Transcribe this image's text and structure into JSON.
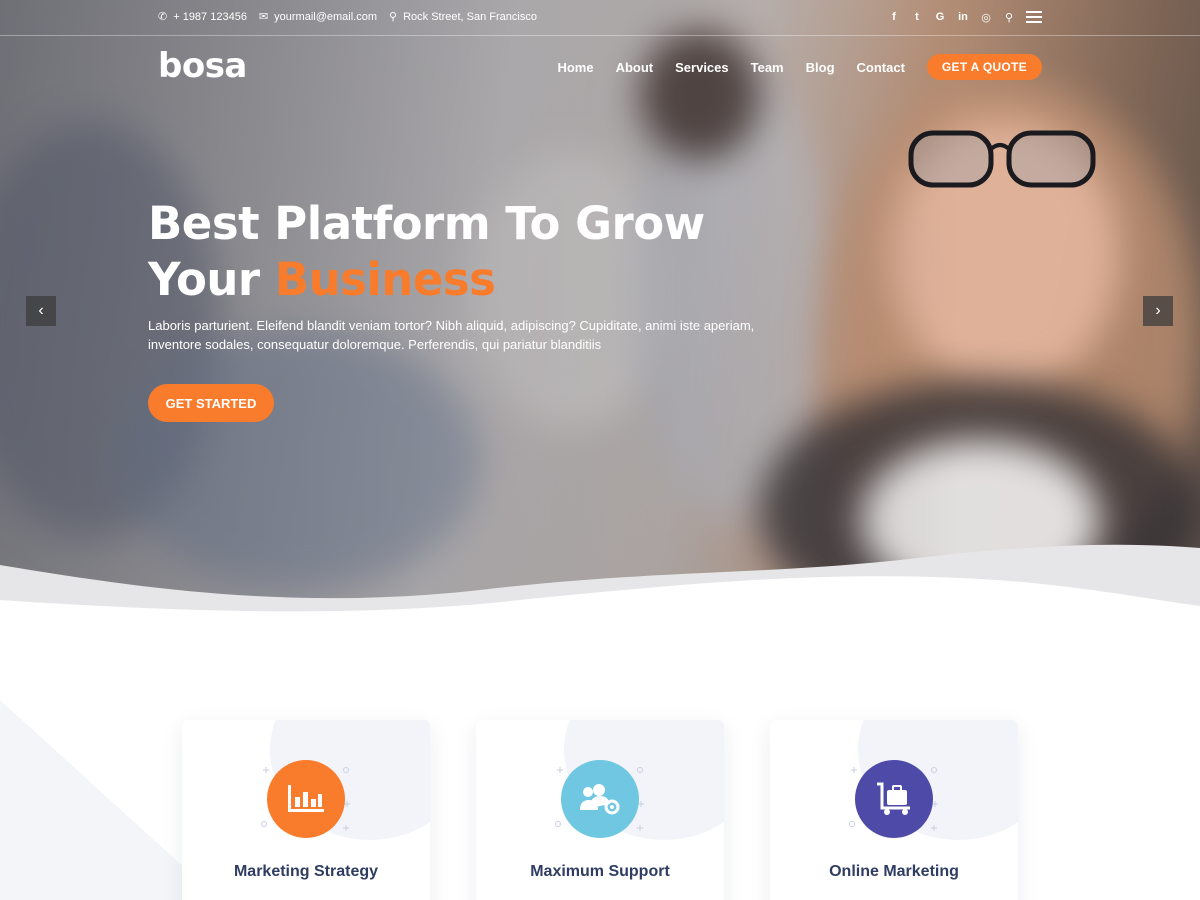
{
  "topbar": {
    "phone": "+ 1987 123456",
    "email": "yourmail@email.com",
    "address": "Rock Street, San Francisco",
    "social_icons": [
      "facebook-icon",
      "twitter-icon",
      "google-icon",
      "linkedin-icon",
      "instagram-icon",
      "search-icon",
      "menu-icon"
    ]
  },
  "brand": {
    "logo_text": "bosa"
  },
  "nav": {
    "items": [
      {
        "label": "Home"
      },
      {
        "label": "About"
      },
      {
        "label": "Services"
      },
      {
        "label": "Team"
      },
      {
        "label": "Blog"
      },
      {
        "label": "Contact"
      }
    ],
    "cta_label": "GET A QUOTE"
  },
  "hero": {
    "title_line1": "Best Platform To Grow",
    "title_line2_prefix": "Your ",
    "title_line2_accent": "Business",
    "description": "Laboris parturient. Eleifend blandit veniam tortor? Nibh aliquid, adipiscing? Cupiditate, animi iste aperiam, inventore sodales, consequatur doloremque. Perferendis, qui pariatur blanditiis",
    "cta_label": "GET STARTED",
    "prev_arrow": "‹",
    "next_arrow": "›"
  },
  "services": [
    {
      "title": "Marketing Strategy",
      "icon": "bar-chart-icon",
      "color": "#f97c2d"
    },
    {
      "title": "Maximum Support",
      "icon": "users-gear-icon",
      "color": "#6fc7e1"
    },
    {
      "title": "Online Marketing",
      "icon": "luggage-cart-icon",
      "color": "#4d4aa8"
    }
  ],
  "colors": {
    "accent": "#f97c2d",
    "heading": "#2f3d63"
  }
}
